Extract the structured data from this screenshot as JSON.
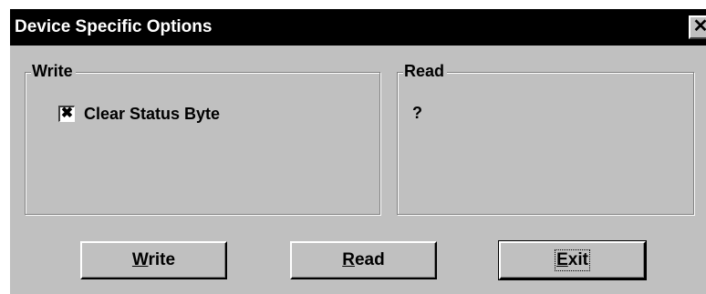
{
  "window": {
    "title": "Device Specific Options",
    "close_glyph": "✕"
  },
  "write_group": {
    "label": "Write",
    "checkbox": {
      "label": "Clear Status Byte",
      "checked": true,
      "glyph": "✖"
    }
  },
  "read_group": {
    "label": "Read",
    "value": "?"
  },
  "buttons": {
    "write": {
      "mnemonic": "W",
      "rest": "rite"
    },
    "read": {
      "mnemonic": "R",
      "rest": "ead"
    },
    "exit": {
      "mnemonic": "E",
      "rest": "xit"
    }
  },
  "colors": {
    "titlebar": "#000000",
    "title_text": "#ffffff",
    "face": "#c0c0c0"
  }
}
